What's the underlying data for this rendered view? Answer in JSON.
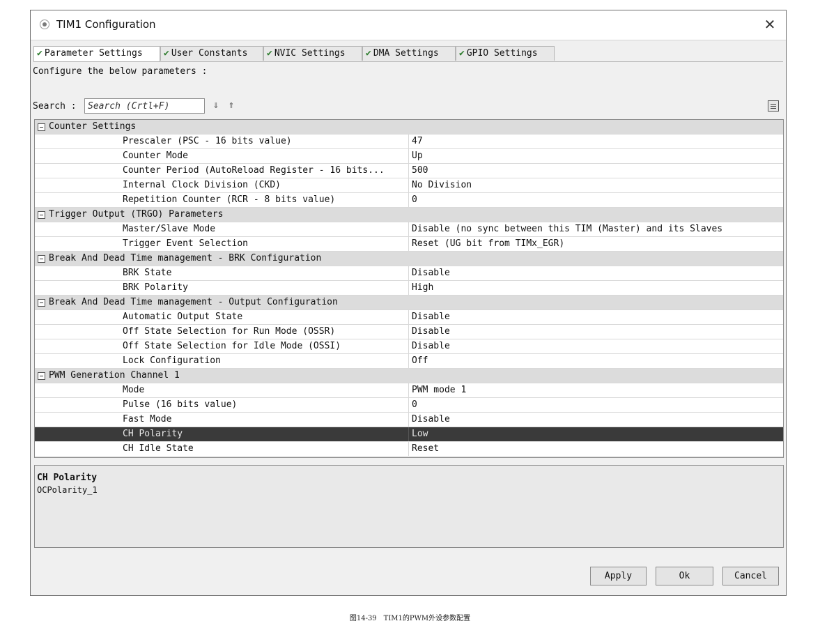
{
  "window": {
    "title": "TIM1 Configuration",
    "close_glyph": "✕"
  },
  "tabs": [
    {
      "label": "Parameter Settings",
      "active": true
    },
    {
      "label": "User Constants",
      "active": false
    },
    {
      "label": "NVIC Settings",
      "active": false
    },
    {
      "label": "DMA Settings",
      "active": false
    },
    {
      "label": "GPIO Settings",
      "active": false
    }
  ],
  "tab_check_glyph": "✔",
  "configure_text": "Configure the below parameters :",
  "search": {
    "label": "Search :",
    "placeholder": "Search (Crtl+F)",
    "down_glyph": "⇓",
    "up_glyph": "⇑"
  },
  "sections": [
    {
      "title": "Counter Settings",
      "params": [
        {
          "name": "Prescaler (PSC - 16 bits value)",
          "value": "47"
        },
        {
          "name": "Counter Mode",
          "value": "Up"
        },
        {
          "name": "Counter Period (AutoReload Register - 16 bits...",
          "value": "500"
        },
        {
          "name": "Internal Clock Division (CKD)",
          "value": "No Division"
        },
        {
          "name": "Repetition Counter (RCR - 8 bits value)",
          "value": "0"
        }
      ]
    },
    {
      "title": "Trigger Output (TRGO) Parameters",
      "params": [
        {
          "name": "Master/Slave Mode",
          "value": "Disable (no sync between this TIM (Master) and its Slaves"
        },
        {
          "name": "Trigger Event Selection",
          "value": "Reset (UG bit from TIMx_EGR)"
        }
      ]
    },
    {
      "title": "Break And Dead Time management - BRK Configuration",
      "params": [
        {
          "name": "BRK State",
          "value": "Disable"
        },
        {
          "name": "BRK Polarity",
          "value": "High"
        }
      ]
    },
    {
      "title": "Break And Dead Time management - Output Configuration",
      "params": [
        {
          "name": "Automatic Output State",
          "value": "Disable"
        },
        {
          "name": "Off State Selection for Run Mode (OSSR)",
          "value": "Disable"
        },
        {
          "name": "Off State Selection for Idle Mode (OSSI)",
          "value": "Disable"
        },
        {
          "name": "Lock Configuration",
          "value": "Off"
        }
      ]
    },
    {
      "title": "PWM Generation Channel 1",
      "params": [
        {
          "name": "Mode",
          "value": "PWM mode 1"
        },
        {
          "name": "Pulse (16 bits value)",
          "value": "0"
        },
        {
          "name": "Fast Mode",
          "value": "Disable"
        },
        {
          "name": "CH Polarity",
          "value": "Low",
          "selected": true
        },
        {
          "name": "CH Idle State",
          "value": "Reset"
        }
      ]
    }
  ],
  "description": {
    "title": "CH Polarity",
    "text": "OCPolarity_1"
  },
  "buttons": {
    "apply": "Apply",
    "ok": "Ok",
    "cancel": "Cancel"
  },
  "caption": "图14-39　TIM1的PWM外设参数配置"
}
